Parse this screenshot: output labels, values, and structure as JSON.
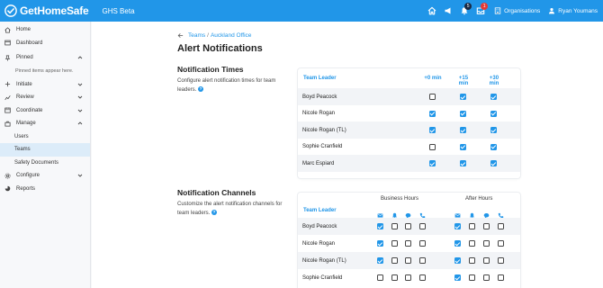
{
  "topbar": {
    "app_name": "GetHomeSafe",
    "env_label": "GHS Beta",
    "icons": [
      "home-icon",
      "megaphone-icon",
      "bell-icon",
      "inbox-icon"
    ],
    "bell_badge": "5",
    "inbox_badge": "1",
    "org_label": "Organisations",
    "user_name": "Ryan Youmans",
    "brand_color": "#2196e8"
  },
  "sidebar": {
    "home": "Home",
    "dashboard": "Dashboard",
    "pinned": "Pinned",
    "pinned_note": "Pinned items appear here.",
    "initiate": "Initiate",
    "review": "Review",
    "coordinate": "Coordinate",
    "manage": "Manage",
    "users": "Users",
    "teams": "Teams",
    "safety_documents": "Safety Documents",
    "configure": "Configure",
    "reports": "Reports"
  },
  "main": {
    "breadcrumb_teams": "Teams",
    "breadcrumb_sep": "/",
    "breadcrumb_office": "Auckland Office",
    "page_title": "Alert Notifications"
  },
  "notification_times": {
    "title": "Notification Times",
    "description": "Configure alert notification times for team leaders.",
    "columns": [
      "Team Leader",
      "+0 min",
      "+15 min",
      "+30 min"
    ],
    "rows": [
      {
        "name": "Boyd Peacock",
        "checks": [
          false,
          true,
          true
        ]
      },
      {
        "name": "Nicole Rogan",
        "checks": [
          true,
          true,
          true
        ]
      },
      {
        "name": "Nicole Rogan (TL)",
        "checks": [
          true,
          true,
          true
        ]
      },
      {
        "name": "Sophie Cranfield",
        "checks": [
          false,
          true,
          true
        ]
      },
      {
        "name": "Marc Espiard",
        "checks": [
          true,
          true,
          true
        ]
      }
    ]
  },
  "notification_channels": {
    "title": "Notification Channels",
    "description": "Customize the alert notification channels for team leaders.",
    "column_header": "Team Leader",
    "group_business": "Business Hours",
    "group_after": "After Hours",
    "channel_icons": [
      "email-icon",
      "bell-icon",
      "chat-icon",
      "phone-icon"
    ],
    "rows": [
      {
        "name": "Boyd Peacock",
        "business": [
          true,
          false,
          false,
          false
        ],
        "after": [
          true,
          false,
          false,
          false
        ]
      },
      {
        "name": "Nicole Rogan",
        "business": [
          true,
          false,
          false,
          false
        ],
        "after": [
          true,
          false,
          false,
          false
        ]
      },
      {
        "name": "Nicole Rogan (TL)",
        "business": [
          true,
          false,
          false,
          false
        ],
        "after": [
          true,
          false,
          false,
          false
        ]
      },
      {
        "name": "Sophie Cranfield",
        "business": [
          false,
          false,
          false,
          false
        ],
        "after": [
          true,
          false,
          false,
          false
        ]
      }
    ]
  }
}
